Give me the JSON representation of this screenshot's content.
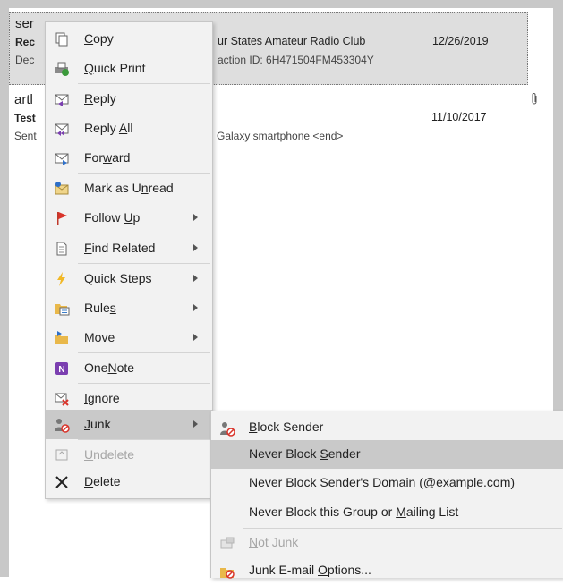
{
  "messages": [
    {
      "sender": "ser",
      "subject": "Rec",
      "subject_tail": "ur States Amateur Radio Club",
      "preview": "Dec",
      "preview_tail": "action ID: 6H471504FM453304Y",
      "date": "12/26/2019",
      "selected": true
    },
    {
      "sender": "artl",
      "subject": "Test",
      "preview": "Sent",
      "preview_tail": "Galaxy smartphone <end>",
      "date": "11/10/2017",
      "attachment_icon": "paperclip-icon"
    }
  ],
  "context_menu": {
    "items": [
      {
        "icon": "copy-icon",
        "pre": "",
        "u": "C",
        "post": "opy"
      },
      {
        "icon": "quick-print-icon",
        "pre": "",
        "u": "Q",
        "post": "uick Print"
      },
      {
        "icon": "reply-icon",
        "pre": "",
        "u": "R",
        "post": "eply"
      },
      {
        "icon": "reply-all-icon",
        "pre": "Reply ",
        "u": "A",
        "post": "ll"
      },
      {
        "icon": "forward-icon",
        "pre": "For",
        "u": "w",
        "post": "ard"
      },
      {
        "icon": "mark-unread-icon",
        "pre": "Mark as U",
        "u": "n",
        "post": "read"
      },
      {
        "icon": "flag-icon",
        "pre": "Follow ",
        "u": "U",
        "post": "p",
        "submenu": true
      },
      {
        "icon": "find-related-icon",
        "pre": "",
        "u": "F",
        "post": "ind Related",
        "submenu": true
      },
      {
        "icon": "quick-steps-icon",
        "pre": "",
        "u": "Q",
        "post": "uick Steps",
        "submenu": true
      },
      {
        "icon": "rules-icon",
        "pre": "Rule",
        "u": "s",
        "post": "",
        "submenu": true
      },
      {
        "icon": "move-icon",
        "pre": "",
        "u": "M",
        "post": "ove",
        "submenu": true
      },
      {
        "icon": "onenote-icon",
        "pre": "One",
        "u": "N",
        "post": "ote"
      },
      {
        "icon": "ignore-icon",
        "pre": "",
        "u": "I",
        "post": "gnore"
      },
      {
        "icon": "junk-icon",
        "pre": "",
        "u": "J",
        "post": "unk",
        "submenu": true,
        "highlight": true
      },
      {
        "icon": "undelete-icon",
        "pre": "",
        "u": "U",
        "post": "ndelete",
        "disabled": true
      },
      {
        "icon": "delete-icon",
        "pre": "",
        "u": "D",
        "post": "elete"
      }
    ]
  },
  "junk_submenu": {
    "items": [
      {
        "icon": "block-sender-icon",
        "pre": "",
        "u": "B",
        "post": "lock Sender"
      },
      {
        "icon": "",
        "pre": "Never Block ",
        "u": "S",
        "post": "ender",
        "highlight": true
      },
      {
        "icon": "",
        "pre": "Never Block Sender's ",
        "u": "D",
        "post": "omain (@example.com)"
      },
      {
        "icon": "",
        "pre": "Never Block this Group or ",
        "u": "M",
        "post": "ailing List"
      },
      {
        "icon": "not-junk-icon",
        "pre": "",
        "u": "N",
        "post": "ot Junk",
        "disabled": true
      },
      {
        "icon": "junk-options-icon",
        "pre": "Junk E-mail ",
        "u": "O",
        "post": "ptions..."
      }
    ]
  }
}
